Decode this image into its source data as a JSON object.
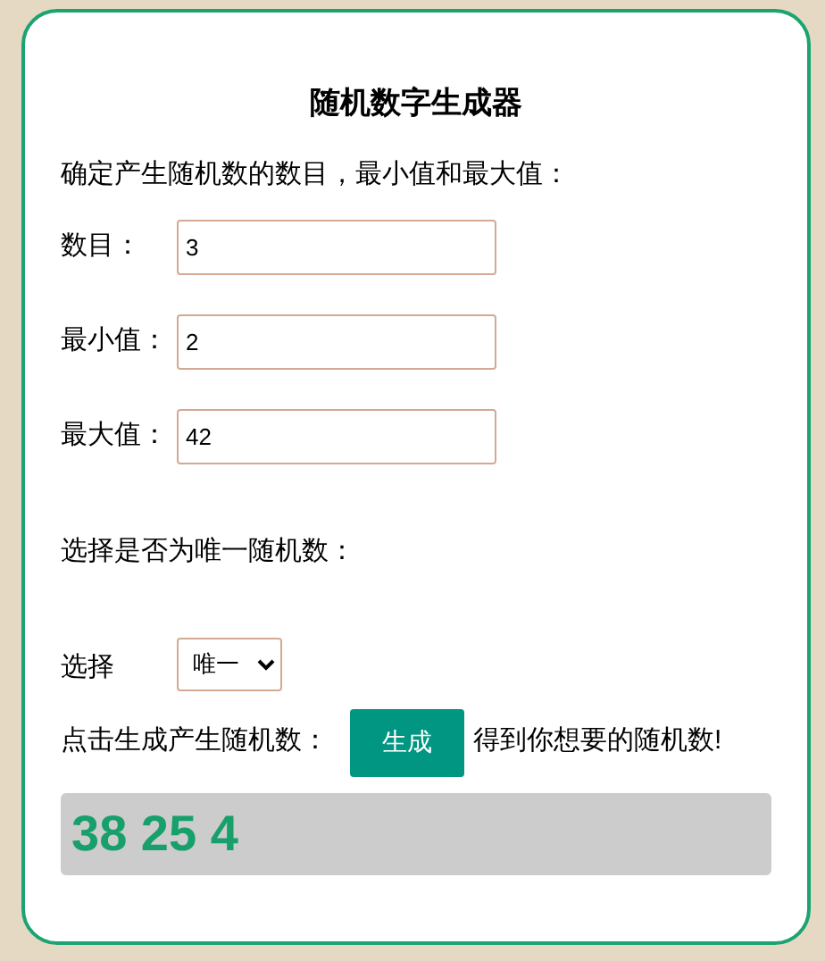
{
  "title": "随机数字生成器",
  "instruction": "确定产生随机数的数目，最小值和最大值：",
  "fields": [
    {
      "label": "数目：",
      "value": "3"
    },
    {
      "label": "最小值：",
      "value": "2"
    },
    {
      "label": "最大值：",
      "value": "42"
    }
  ],
  "unique_prompt": "选择是否为唯一随机数：",
  "select": {
    "label": "选择",
    "value": "唯一"
  },
  "generate": {
    "prefix": "点击生成产生随机数：",
    "button": "生成",
    "suffix": "得到你想要的随机数!"
  },
  "result": "38 25 4"
}
